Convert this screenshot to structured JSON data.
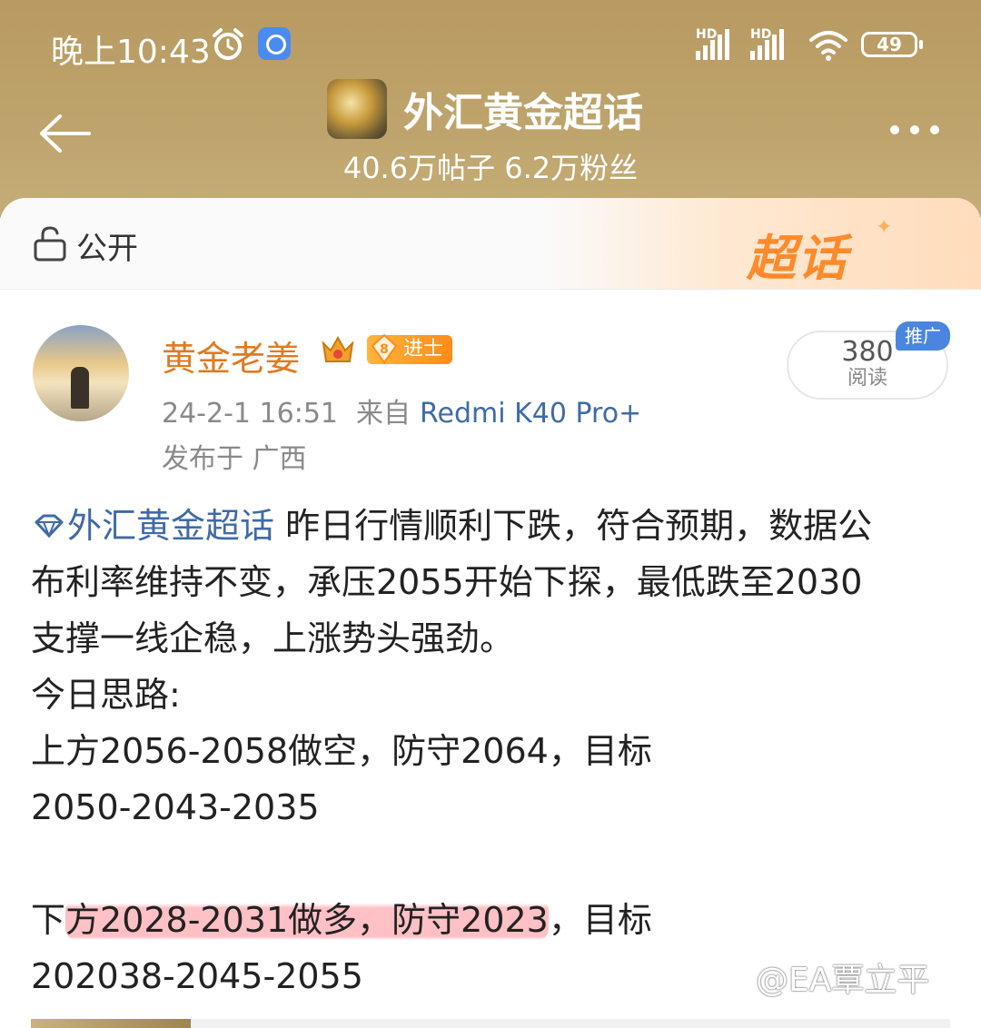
{
  "status_bar": {
    "time": "晚上10:43",
    "signal1_label": "HD",
    "signal2_label": "HD",
    "battery": "49",
    "icons": [
      "alarm-icon",
      "app-badge-icon",
      "signal-icon",
      "wifi-icon",
      "battery-icon"
    ]
  },
  "header": {
    "topic_title": "外汇黄金超话",
    "stats": "40.6万帖子 6.2万粉丝"
  },
  "visibility": {
    "label": "公开",
    "brand": "超话"
  },
  "post": {
    "author": "黄金老姜",
    "rank_level": "8",
    "rank_label": "进士",
    "time": "24-2-1 16:51",
    "from_label": "来自",
    "device": "Redmi K40 Pro+",
    "location": "发布于 广西",
    "promo_tag": "推广",
    "read_count": "380",
    "read_label": "阅读",
    "topic_link": "外汇黄金超话",
    "lines": {
      "l1": " 昨日行情顺利下跌，符合预期，数据公",
      "l2": "布利率维持不变，承压2055开始下探，最低跌至2030",
      "l3": "支撑一线企稳，上涨势头强劲。",
      "l4": "今日思路:",
      "l5": "上方2056-2058做空，防守2064，目标",
      "l6": "2050-2043-2035",
      "l8_pre": "下",
      "l8_highlight": "方2028-2031做多，防守2023",
      "l8_post": "，目标",
      "l9": "202038-2045-2055"
    }
  },
  "watermark": "@EA覃立平",
  "colors": {
    "header_bg": "#bea46c",
    "author": "#e07a1f",
    "link": "#3f6aa8",
    "brand": "#ff8a2c",
    "promo": "#4a86e0"
  }
}
